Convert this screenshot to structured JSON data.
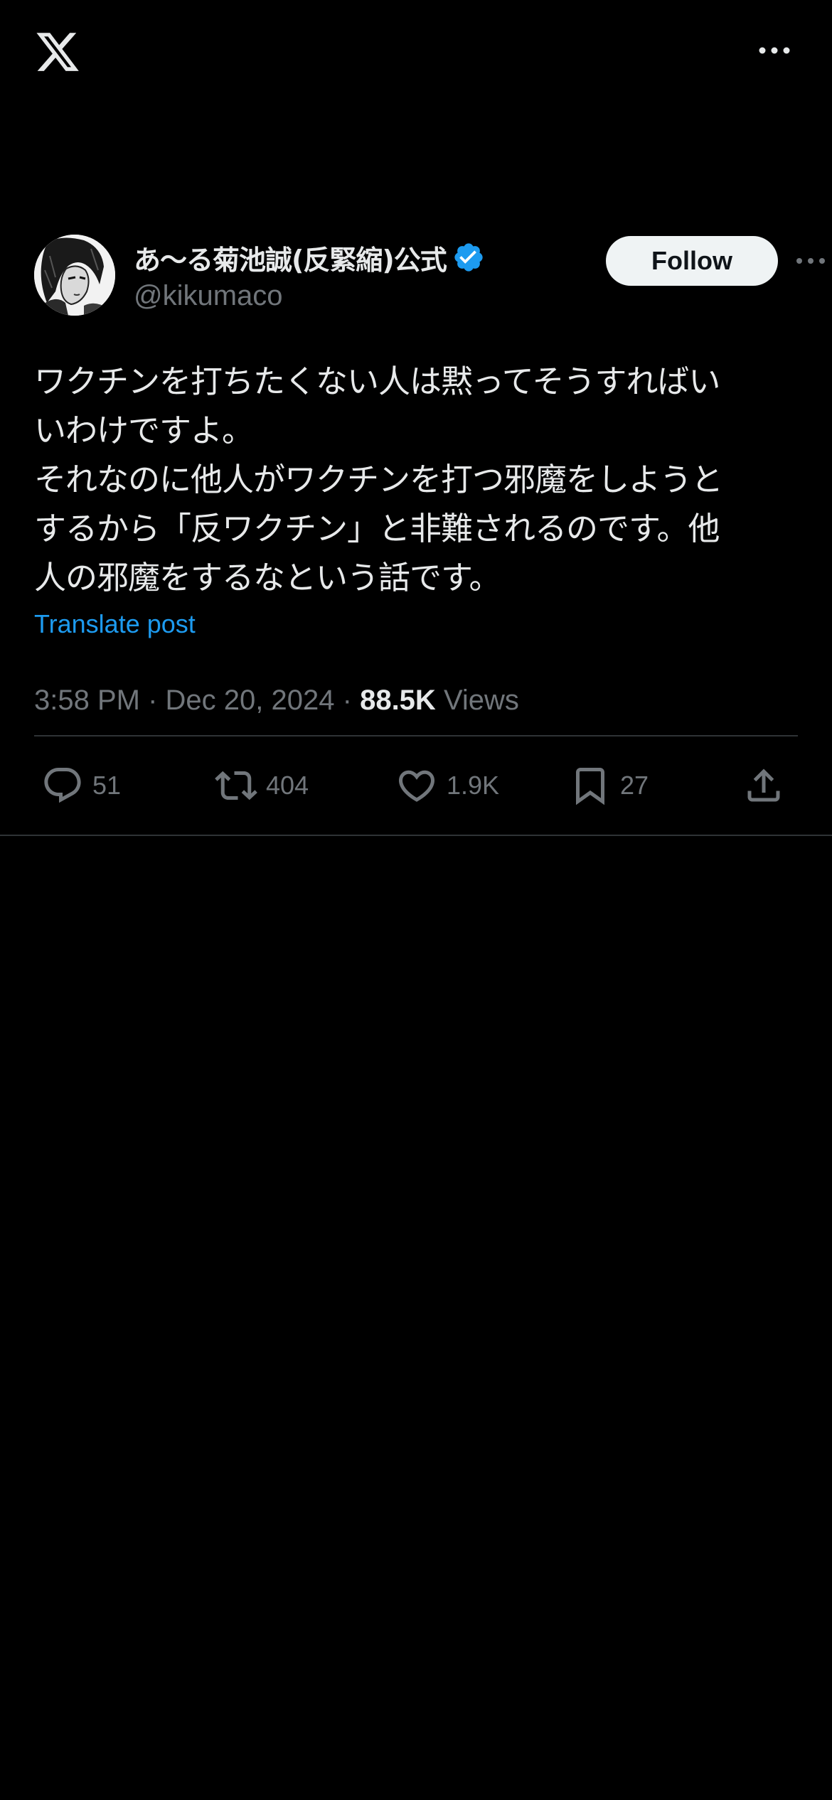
{
  "top_bar": {
    "logo_icon": "x-logo-icon",
    "more_icon": "more-horizontal-icon"
  },
  "author": {
    "display_name": "あ〜る菊池誠(反緊縮)公式",
    "handle": "@kikumaco",
    "verified_icon": "verified-badge-icon",
    "verified_color": "#1d9bf0"
  },
  "follow_button": {
    "label": "Follow"
  },
  "tweet": {
    "text": "ワクチンを打ちたくない人は黙ってそうすればい\nいわけですよ。\nそれなのに他人がワクチンを打つ邪魔をしようと\nするから「反ワクチン」と非難されるのです。他\n人の邪魔をするなという話です。",
    "translate_label": "Translate post",
    "time": "3:58 PM",
    "separator": "·",
    "date": "Dec 20, 2024",
    "views_count": "88.5K",
    "views_label": "Views"
  },
  "actions": {
    "reply": {
      "icon": "reply-icon",
      "count": "51"
    },
    "repost": {
      "icon": "repost-icon",
      "count": "404"
    },
    "like": {
      "icon": "heart-icon",
      "count": "1.9K"
    },
    "bookmark": {
      "icon": "bookmark-icon",
      "count": "27"
    },
    "share": {
      "icon": "share-icon"
    }
  },
  "colors": {
    "background": "#000000",
    "text_primary": "#e7e9ea",
    "text_secondary": "#71767b",
    "accent": "#1d9bf0",
    "divider": "#2f3336",
    "follow_bg": "#eff3f4"
  }
}
